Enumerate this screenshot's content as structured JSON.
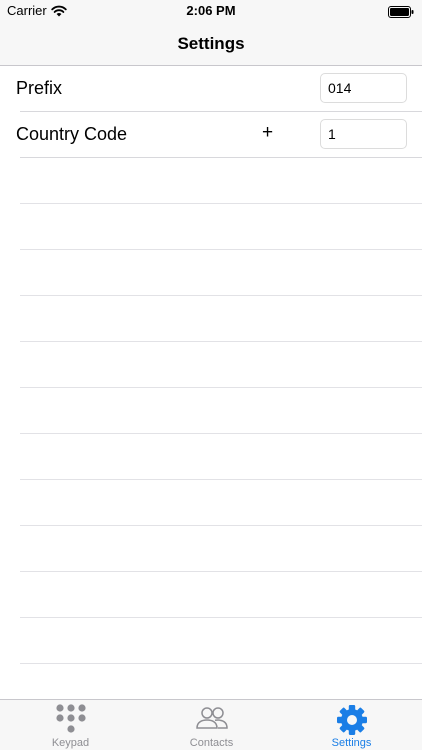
{
  "status_bar": {
    "carrier": "Carrier",
    "time": "2:06 PM"
  },
  "nav": {
    "title": "Settings"
  },
  "settings": {
    "prefix": {
      "label": "Prefix",
      "value": "014"
    },
    "country_code": {
      "label": "Country Code",
      "symbol": "+",
      "value": "1"
    }
  },
  "tabs": [
    {
      "label": "Keypad",
      "icon": "keypad-icon",
      "selected": false
    },
    {
      "label": "Contacts",
      "icon": "contacts-icon",
      "selected": false
    },
    {
      "label": "Settings",
      "icon": "gear-icon",
      "selected": true
    }
  ],
  "colors": {
    "accent": "#1a7ee6",
    "tab_inactive": "#8e8e93"
  }
}
